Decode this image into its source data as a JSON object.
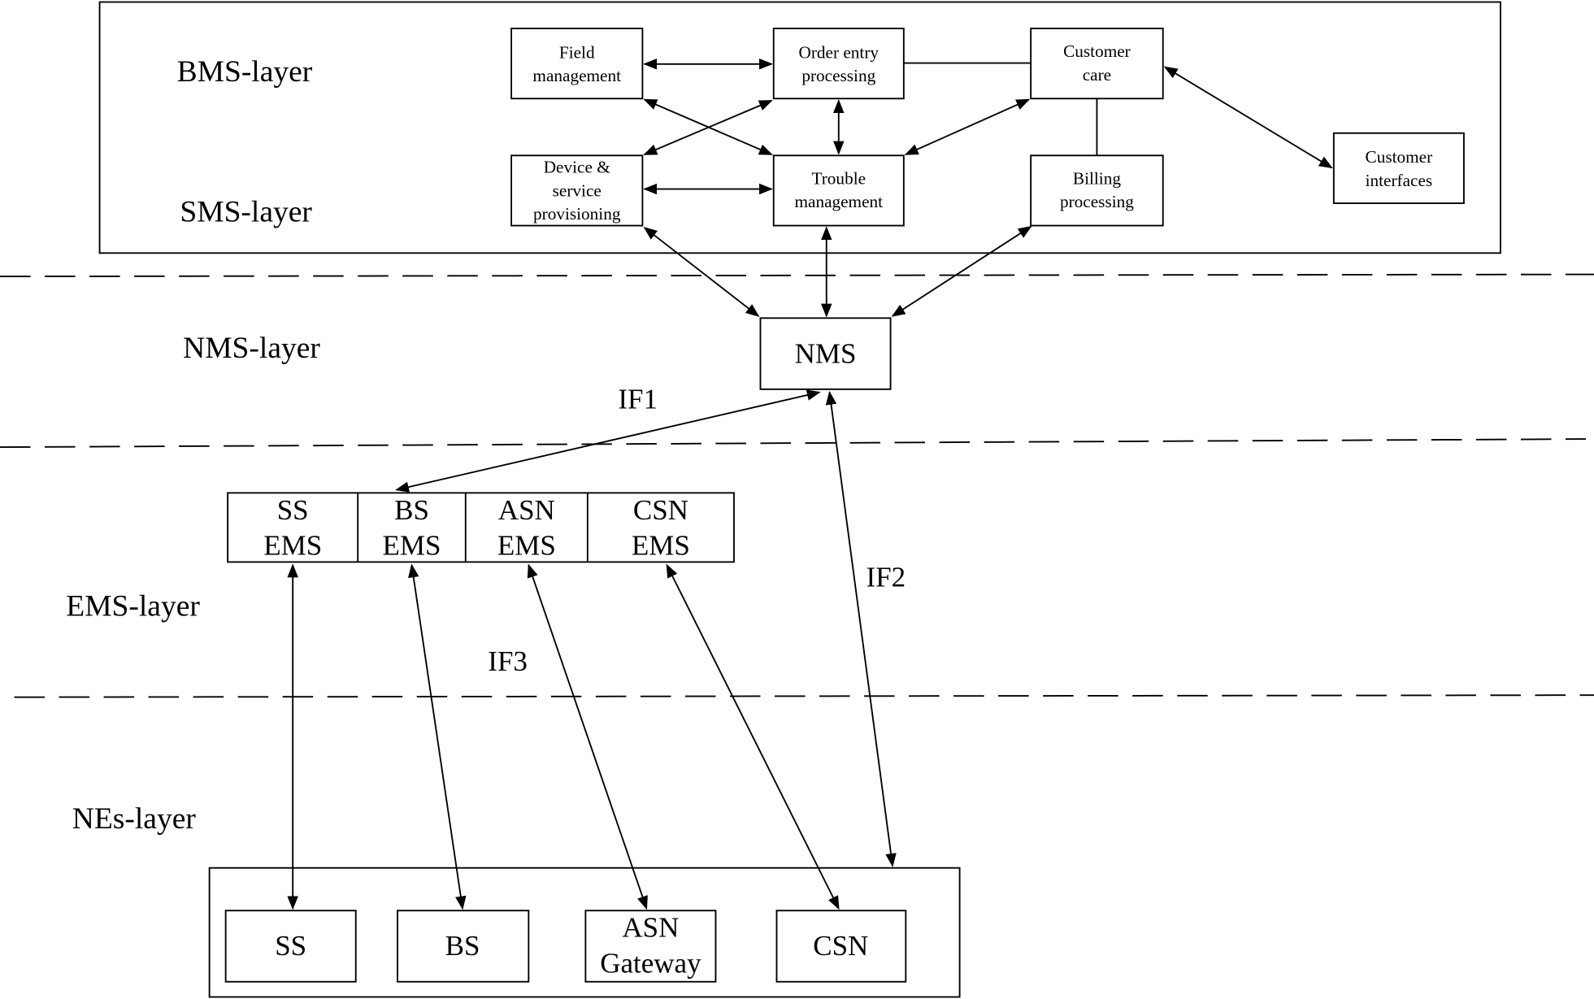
{
  "layers": {
    "bms": "BMS-layer",
    "sms": "SMS-layer",
    "nms": "NMS-layer",
    "ems": "EMS-layer",
    "nes": "NEs-layer"
  },
  "top_boxes": {
    "field": [
      "Field",
      "management"
    ],
    "order": [
      "Order entry",
      "processing"
    ],
    "care": [
      "Customer",
      "care"
    ],
    "device": [
      "Device &",
      "service",
      "provisioning"
    ],
    "trouble": [
      "Trouble",
      "management"
    ],
    "billing": [
      "Billing",
      "processing"
    ],
    "interfaces": [
      "Customer",
      "interfaces"
    ]
  },
  "nms": "NMS",
  "ems": [
    [
      "SS",
      "EMS"
    ],
    [
      "BS",
      "EMS"
    ],
    [
      "ASN",
      "EMS"
    ],
    [
      "CSN",
      "EMS"
    ]
  ],
  "nes": [
    [
      "SS"
    ],
    [
      "BS"
    ],
    [
      "ASN",
      "Gateway"
    ],
    [
      "CSN"
    ]
  ],
  "interfaces": {
    "if1": "IF1",
    "if2": "IF2",
    "if3": "IF3"
  }
}
